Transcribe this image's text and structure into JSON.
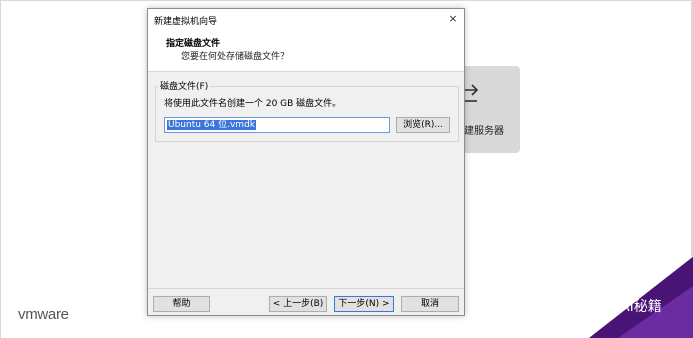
{
  "background": {
    "card_label": "建服务器",
    "logo_text": "vmware",
    "watermark_text": "AI秘籍"
  },
  "dialog": {
    "title": "新建虚拟机向导",
    "close_label": "×",
    "header_title": "指定磁盘文件",
    "header_subtitle": "您要在何处存储磁盘文件？",
    "group_label": "磁盘文件(F)",
    "group_description": "将使用此文件名创建一个 20 GB 磁盘文件。",
    "file_value": "Ubuntu 64 位.vmdk",
    "browse_label": "浏览(R)...",
    "help_label": "帮助",
    "back_label": "< 上一步(B)",
    "next_label": "下一步(N) >",
    "cancel_label": "取消"
  },
  "colors": {
    "selection": "#3a77d9",
    "brand_purple": "#5b1a8c"
  }
}
